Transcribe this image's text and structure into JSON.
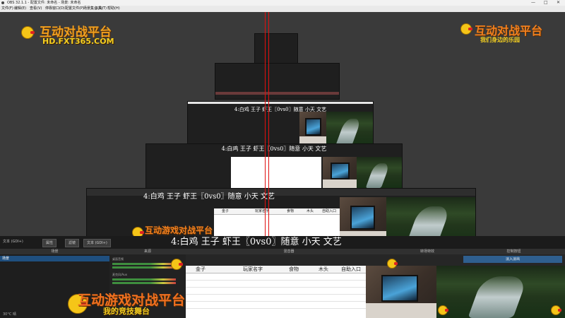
{
  "window": {
    "title": "OBS 32.1.1 - 配置文件: 未命名 - 场景: 未命名",
    "controls": [
      "—",
      "□",
      "✕"
    ]
  },
  "menu": {
    "items": [
      "文件(F)",
      "编辑(E)",
      "查看(V)",
      "停靠窗口(D)",
      "配置文件(P)",
      "场景集合(S)",
      "工具(T)",
      "帮助(H)"
    ]
  },
  "branding": {
    "left_logo": "互动对战平台",
    "left_url": "HD.FXT365.COM",
    "right_logo": "互动对战平台",
    "right_slogan": "我们身边的乐园",
    "bottom_logo": "互动游戏对战平台",
    "bottom_slogan": "我的竞技舞台"
  },
  "subtitle": {
    "text": "4:白鸡 王子 虾王〖0vs0〗随意 小天 文艺"
  },
  "sheet": {
    "columns": [
      "金子",
      "玩家名字",
      "食物",
      "木头",
      "自助入口"
    ]
  },
  "toolbar": {
    "source_name": "文本 (GDI+)",
    "properties": "属性",
    "filters": "滤镜",
    "text_label": "文本 (GDI+)"
  },
  "docks": {
    "scenes": "场景",
    "sources": "来源",
    "mixer": "混音器",
    "transitions": "转场特效",
    "controls": "控制按钮"
  },
  "scene_items": [
    "场景"
  ],
  "mixer_channels": [
    "桌面音频",
    "麦克风/Aux"
  ],
  "transition_selected": "淡入淡出",
  "status": {
    "temp": "30°C",
    "label": "晴"
  }
}
